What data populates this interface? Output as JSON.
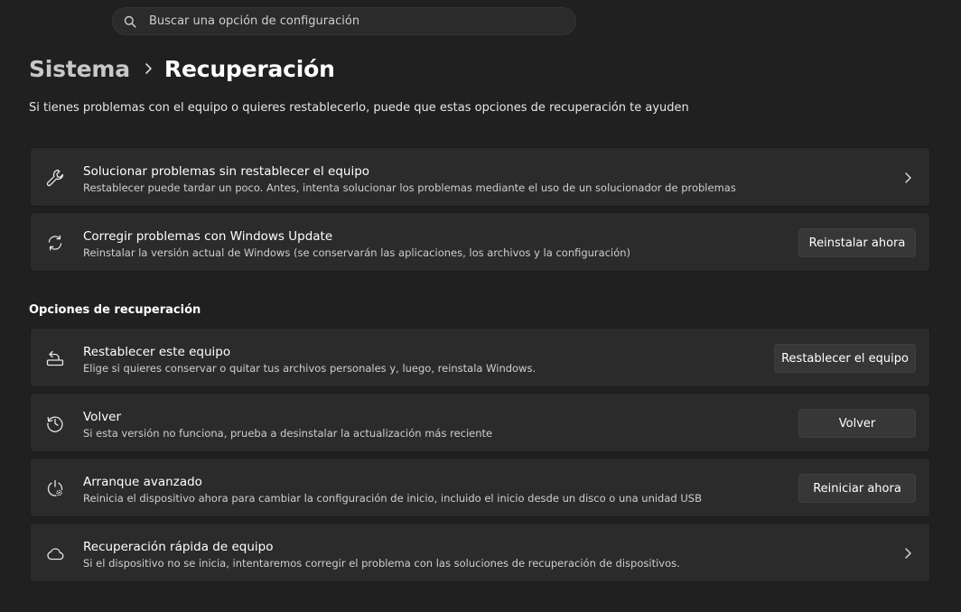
{
  "search": {
    "placeholder": "Buscar una opción de configuración"
  },
  "breadcrumb": {
    "parent": "Sistema",
    "current": "Recuperación"
  },
  "description": "Si tienes problemas con el equipo o quieres restablecerlo, puede que estas opciones de recuperación te ayuden",
  "top_cards": [
    {
      "title": "Solucionar problemas sin restablecer el equipo",
      "subtitle": "Restablecer puede tardar un poco. Antes, intenta solucionar los problemas mediante el uso de un solucionador de problemas",
      "icon": "wrench-icon"
    },
    {
      "title": "Corregir problemas con Windows Update",
      "subtitle": "Reinstalar la versión actual de Windows (se conservarán las aplicaciones, los archivos y la configuración)",
      "icon": "sync-icon",
      "button": "Reinstalar ahora"
    }
  ],
  "recovery_section": {
    "title": "Opciones de recuperación",
    "items": [
      {
        "title": "Restablecer este equipo",
        "subtitle": "Elige si quieres conservar o quitar tus archivos personales y, luego, reinstala Windows.",
        "icon": "reset-pc-icon",
        "button": "Restablecer el equipo"
      },
      {
        "title": "Volver",
        "subtitle": "Si esta versión no funciona, prueba a desinstalar la actualización más reciente",
        "icon": "history-icon",
        "button": "Volver"
      },
      {
        "title": "Arranque avanzado",
        "subtitle": "Reinicia el dispositivo ahora para cambiar la configuración de inicio, incluido el inicio desde un disco o una unidad USB",
        "icon": "advanced-startup-icon",
        "button": "Reiniciar ahora"
      },
      {
        "title": "Recuperación rápida de equipo",
        "subtitle": "Si el dispositivo no se inicia, intentaremos corregir el problema con las soluciones de recuperación de dispositivos.",
        "icon": "cloud-icon"
      }
    ]
  },
  "colors": {
    "background": "#202020",
    "card": "#2b2b2b",
    "button": "#373737",
    "text_secondary": "#cfcfcf"
  }
}
